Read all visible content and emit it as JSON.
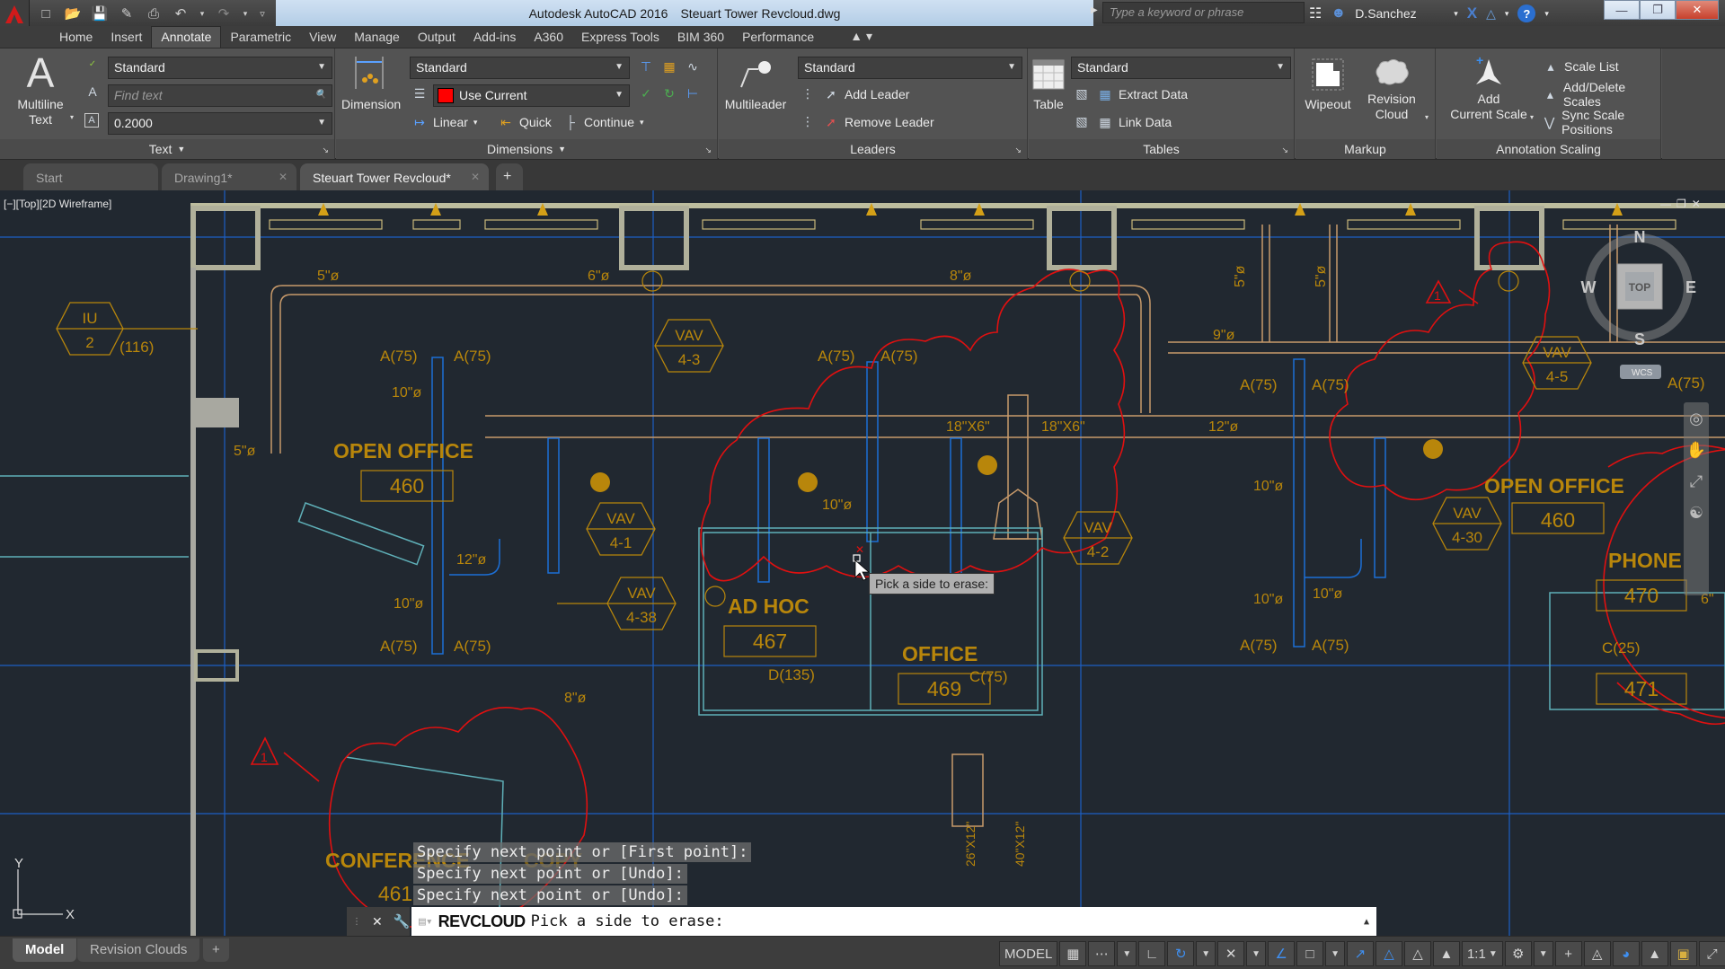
{
  "titlebar": {
    "app_name": "Autodesk AutoCAD 2016",
    "file_name": "Steuart Tower Revcloud.dwg",
    "search_placeholder": "Type a keyword or phrase",
    "user": "D.Sanchez",
    "quick_access": [
      "new-icon",
      "open-icon",
      "save-icon",
      "save-as-icon",
      "plot-icon",
      "undo-icon",
      "redo-icon",
      "customize-icon"
    ]
  },
  "ribbon_tabs": [
    "Home",
    "Insert",
    "Annotate",
    "Parametric",
    "View",
    "Manage",
    "Output",
    "Add-ins",
    "A360",
    "Express Tools",
    "BIM 360",
    "Performance"
  ],
  "active_ribbon_tab": "Annotate",
  "panels": {
    "text": {
      "title": "Text",
      "multiline_text_label": [
        "Multiline",
        "Text"
      ],
      "text_style": "Standard",
      "find_placeholder": "Find text",
      "text_height": "0.2000"
    },
    "dimensions": {
      "title": "Dimensions",
      "dimension_label": "Dimension",
      "dim_style": "Standard",
      "layer": "Use Current",
      "layer_color": "#ff0000",
      "linear_label": "Linear",
      "quick_label": "Quick",
      "continue_label": "Continue"
    },
    "leaders": {
      "title": "Leaders",
      "multileader_label": "Multileader",
      "style": "Standard",
      "add_leader": "Add Leader",
      "remove_leader": "Remove Leader"
    },
    "tables": {
      "title": "Tables",
      "table_label": "Table",
      "style": "Standard",
      "extract_data": "Extract Data",
      "link_data": "Link Data"
    },
    "markup": {
      "title": "Markup",
      "wipeout": "Wipeout",
      "revision_cloud": [
        "Revision",
        "Cloud"
      ]
    },
    "annotation_scaling": {
      "title": "Annotation Scaling",
      "add_current_scale": [
        "Add",
        "Current Scale"
      ],
      "scale_list": "Scale List",
      "add_delete_scales": "Add/Delete Scales",
      "sync_scale_positions": "Sync Scale Positions"
    }
  },
  "file_tabs": [
    {
      "label": "Start",
      "closable": false,
      "active": false
    },
    {
      "label": "Drawing1*",
      "closable": true,
      "active": false
    },
    {
      "label": "Steuart Tower Revcloud*",
      "closable": true,
      "active": true
    }
  ],
  "viewport": {
    "label": "[−][Top][2D Wireframe]",
    "viewcube": {
      "face": "TOP",
      "north": "N",
      "south": "S",
      "east": "E",
      "west": "W",
      "ucs": "WCS"
    },
    "ucs_icon": {
      "x": "X",
      "y": "Y"
    }
  },
  "drawing": {
    "rooms": [
      {
        "name": "OPEN OFFICE",
        "number": "460"
      },
      {
        "name": "AD HOC",
        "number": "467"
      },
      {
        "name": "OFFICE",
        "number": "469"
      },
      {
        "name": "OPEN OFFICE",
        "number": "460"
      },
      {
        "name": "PHONE",
        "number": "470"
      },
      {
        "name": "PHONE",
        "number": "471"
      },
      {
        "name": "CONFERENCE",
        "number": "461"
      },
      {
        "name": "COPY",
        "number": ""
      }
    ],
    "tags": [
      {
        "top": "IU",
        "bottom": "2"
      },
      {
        "top": "VAV",
        "bottom": "4-3"
      },
      {
        "top": "VAV",
        "bottom": "4-1"
      },
      {
        "top": "VAV",
        "bottom": "4-38"
      },
      {
        "top": "VAV",
        "bottom": "4-2"
      },
      {
        "top": "VAV",
        "bottom": "4-5"
      },
      {
        "top": "VAV",
        "bottom": "4-30"
      }
    ],
    "duct_labels": [
      "5\"ø",
      "6\"ø",
      "8\"ø",
      "5\"ø",
      "9\"ø",
      "5\"ø",
      "5\"ø",
      "10\"ø",
      "12\"ø",
      "10\"ø",
      "10\"ø",
      "18\"X6\"",
      "18\"X6\"",
      "12\"ø",
      "10\"ø",
      "10\"ø",
      "10\"ø",
      "8\"ø",
      "6\"",
      "26\"X12\"",
      "40\"X12\""
    ],
    "airflow_labels": [
      "A(75)",
      "(116)",
      "D(135)",
      "C(75)",
      "C(25)"
    ],
    "revision_marker": "1"
  },
  "tooltip": "Pick a side to erase:",
  "command": {
    "history": [
      "Specify next point or [First point]:",
      "Specify next point or [Undo]:",
      "Specify next point or [Undo]:"
    ],
    "current_command": "REVCLOUD",
    "prompt": "Pick a side to erase:"
  },
  "layout_tabs": [
    {
      "label": "Model",
      "active": true
    },
    {
      "label": "Revision Clouds",
      "active": false
    }
  ],
  "status": {
    "model_label": "MODEL",
    "scale": "1:1"
  },
  "colors": {
    "background": "#212830",
    "annotation": "#b8860b",
    "revcloud": "#e01010",
    "duct_blue": "#1c5fc4",
    "wall": "#a8a8a0"
  }
}
